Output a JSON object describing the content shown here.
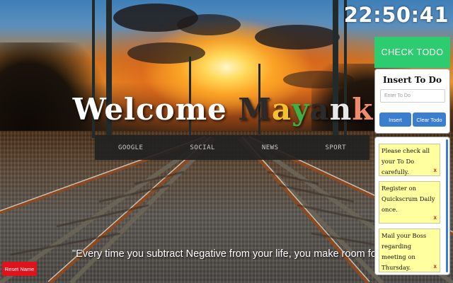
{
  "clock": {
    "time": "22:50:41"
  },
  "welcome": {
    "greeting": "Welcome",
    "name_letters": [
      {
        "char": "M",
        "color": "#2b2b2b"
      },
      {
        "char": "a",
        "color": "#f2c12e"
      },
      {
        "char": "y",
        "color": "#3cb043"
      },
      {
        "char": "a",
        "color": "#2b2b2b"
      },
      {
        "char": "n",
        "color": "#e8e8e8"
      },
      {
        "char": "k",
        "color": "#f08a6a"
      }
    ]
  },
  "nav": {
    "google": "GOOGLE",
    "social": "SOCIAL",
    "news": "NEWS",
    "sport": "SPORT"
  },
  "quote": "\"Every time you subtract Negative from your life, you make room for more Positive\"",
  "reset_label": "Reset Name",
  "todo": {
    "check_label": "CHECK TODO",
    "title": "Insert To Do",
    "input_placeholder": "Enter To Do",
    "input_value": "",
    "insert_label": "Insert",
    "clear_label": "Clear Todo",
    "delete_glyph": "x",
    "items": [
      "Please check all your To Do carefully.",
      "Register on Quickscrum Daily once.",
      "Mail your Boss regarding meeting on Thursday."
    ]
  },
  "colors": {
    "check_todo": "#2ecc71",
    "button_blue": "#3b7ed0",
    "reset_red": "#e0121b",
    "note_yellow": "#ffffa0"
  },
  "icons": [
    "delete-note-icon"
  ]
}
